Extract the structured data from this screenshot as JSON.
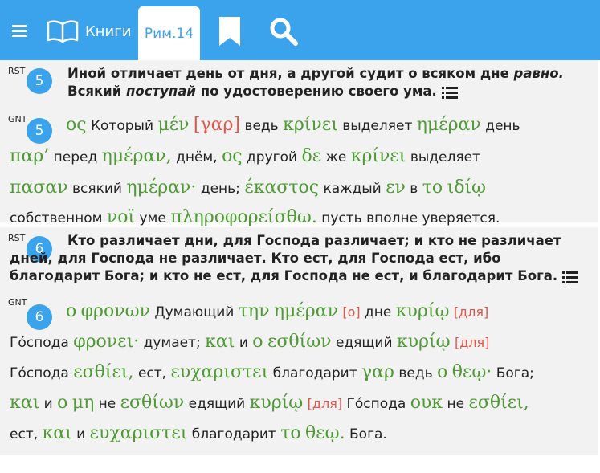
{
  "app": {
    "books_label": "Книги",
    "active_tab": "Рим.14"
  },
  "icons": {
    "menu": "menu-icon",
    "book": "book-icon",
    "bookmark": "bookmark-icon",
    "search": "search-icon",
    "list": "list-icon"
  },
  "colors": {
    "accent": "#3ba3ec",
    "greek": "#4f9a34",
    "variant": "#e0564b"
  },
  "verses": [
    {
      "number": "5",
      "rst_tag": "RST",
      "rst_segments": [
        {
          "t": "Иной отличает день от дня, а другой судит о всяком дне "
        },
        {
          "t": "равно.",
          "i": true
        },
        {
          "t": " Всякий "
        },
        {
          "t": "поступай",
          "i": true
        },
        {
          "t": " по удостоверению своего ума."
        }
      ],
      "gnt_tag": "GNT",
      "gnt_lines": [
        [
          {
            "g": "ος"
          },
          {
            "r": "Который"
          },
          {
            "g": "μέν"
          },
          {
            "vg": "[γαρ]"
          },
          {
            "r": "ведь"
          },
          {
            "g": "κρίνει"
          },
          {
            "r": "выделяет"
          },
          {
            "g": "ημέραν"
          },
          {
            "r": "день"
          }
        ],
        [
          {
            "g": "παρ’"
          },
          {
            "r": "перед"
          },
          {
            "g": "ημέραν,"
          },
          {
            "r": "днём,"
          },
          {
            "g": "ος"
          },
          {
            "r": "другой"
          },
          {
            "g": "δε"
          },
          {
            "r": "же"
          },
          {
            "g": "κρίνει"
          },
          {
            "r": "выделяет"
          }
        ],
        [
          {
            "g": "πασαν"
          },
          {
            "r": "всякий"
          },
          {
            "g": "ημέραν·"
          },
          {
            "r": "день;"
          },
          {
            "g": "έκαστος"
          },
          {
            "r": "каждый"
          },
          {
            "g": "εν"
          },
          {
            "r": "в"
          },
          {
            "g": "το"
          },
          {
            "g": "ιδίῳ"
          }
        ],
        [
          {
            "r": "собственном"
          },
          {
            "g": "νοϊ"
          },
          {
            "r": "уме"
          },
          {
            "g": "πληροφορείσθω."
          },
          {
            "r": "пусть вполне уверяется."
          }
        ]
      ]
    },
    {
      "number": "6",
      "rst_tag": "RST",
      "rst_segments": [
        {
          "t": "Кто различает дни, для Господа различает; и кто не различает дней, для Господа не различает. Кто ест, для Господа ест, ибо благодарит Бога; и кто не ест, для Господа не ест, и благодарит Бога."
        }
      ],
      "gnt_tag": "GNT",
      "gnt_lines": [
        [
          {
            "g": "ο"
          },
          {
            "g": "φρονων"
          },
          {
            "r": "Думающий"
          },
          {
            "g": "την"
          },
          {
            "g": "ημέραν"
          },
          {
            "v": "[ο]"
          },
          {
            "r": "дне"
          },
          {
            "g": "κυρίῳ"
          },
          {
            "v": "[для]"
          }
        ],
        [
          {
            "r": "Го́спода"
          },
          {
            "g": "φρονει·"
          },
          {
            "r": "думает;"
          },
          {
            "g": "και"
          },
          {
            "r": "и"
          },
          {
            "g": "ο"
          },
          {
            "g": "εσθίων"
          },
          {
            "r": "едящий"
          },
          {
            "g": "κυρίῳ"
          },
          {
            "v": "[для]"
          }
        ],
        [
          {
            "r": "Го́спода"
          },
          {
            "g": "εσθίει,"
          },
          {
            "r": "ест,"
          },
          {
            "g": "ευχαριστει"
          },
          {
            "r": "благодарит"
          },
          {
            "g": "γαρ"
          },
          {
            "r": "ведь"
          },
          {
            "g": "ο"
          },
          {
            "g": "θεῳ·"
          },
          {
            "r": "Бога;"
          }
        ],
        [
          {
            "g": "και"
          },
          {
            "r": "и"
          },
          {
            "g": "ο"
          },
          {
            "g": "μη"
          },
          {
            "r": "не"
          },
          {
            "g": "εσθίων"
          },
          {
            "r": "едящий"
          },
          {
            "g": "κυρίῳ"
          },
          {
            "v": "[для]"
          },
          {
            "r": "Го́спода"
          },
          {
            "g": "ουκ"
          },
          {
            "r": "не"
          },
          {
            "g": "εσθίει,"
          }
        ],
        [
          {
            "r": "ест,"
          },
          {
            "g": "και"
          },
          {
            "r": "и"
          },
          {
            "g": "ευχαριστει"
          },
          {
            "r": "благодарит"
          },
          {
            "g": "το"
          },
          {
            "g": "θεῳ."
          },
          {
            "r": "Бога."
          }
        ]
      ]
    }
  ]
}
